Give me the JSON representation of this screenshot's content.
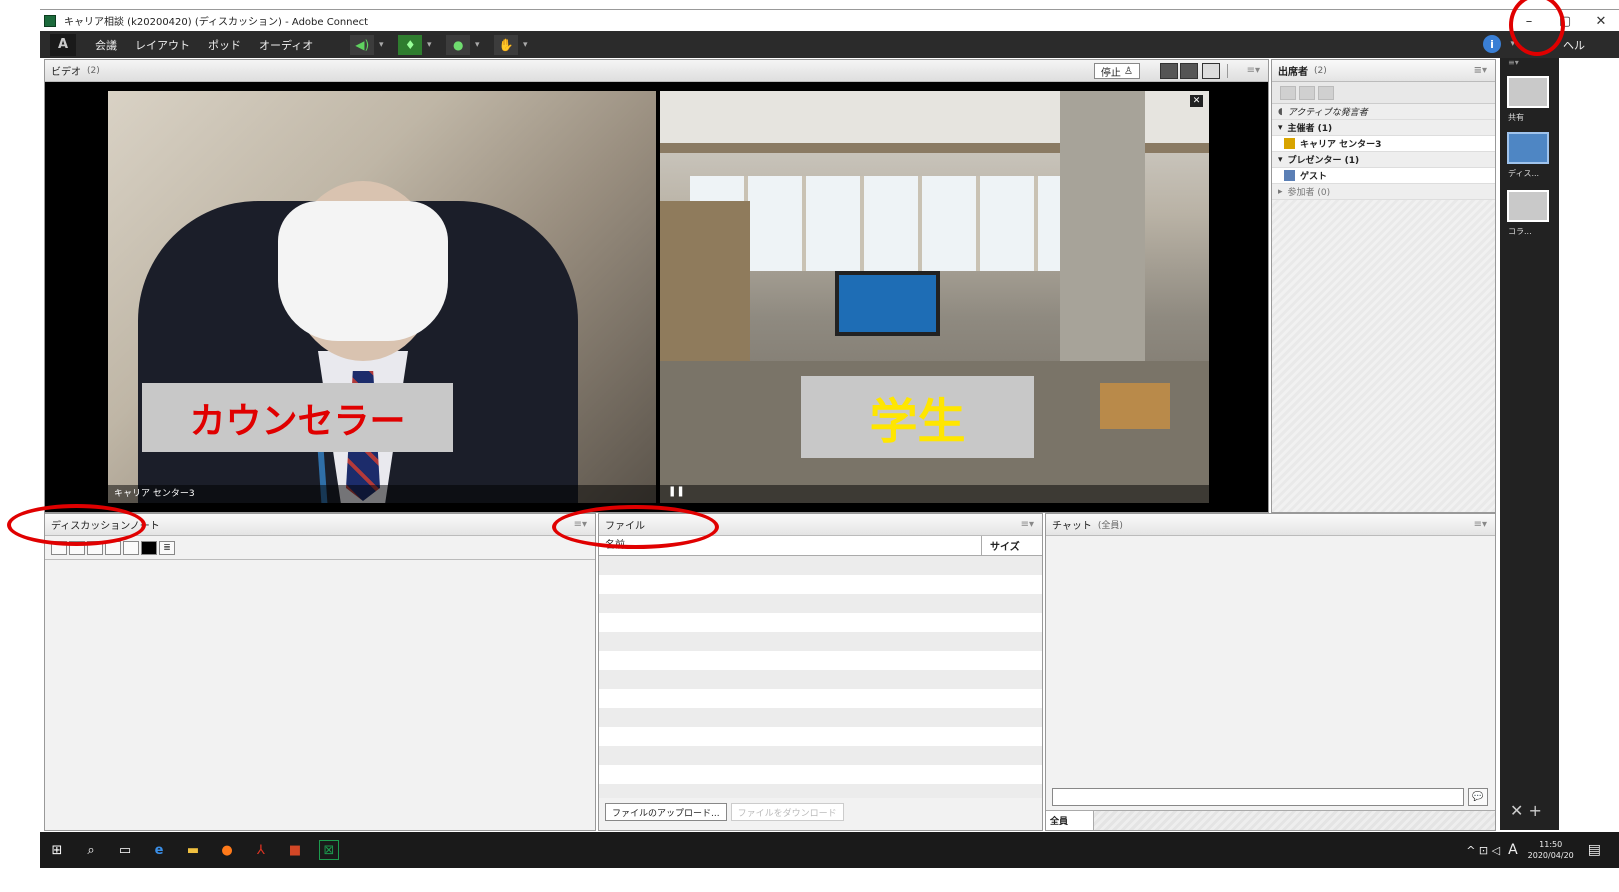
{
  "window": {
    "title": "キャリア相談 (k20200420) (ディスカッション) - Adobe Connect",
    "minimize_icon": "–",
    "restore_icon": "▢",
    "close_icon": "✕"
  },
  "menubar": {
    "logo": "A",
    "items": [
      "会議",
      "レイアウト",
      "ポッド",
      "オーディオ"
    ],
    "help_label": "ヘル"
  },
  "video_pod": {
    "title": "ビデオ",
    "count": "(2)",
    "stop_label": "停止",
    "counselor_name": "キャリア センター3",
    "counselor_overlay": "カウンセラー",
    "student_overlay": "学生",
    "close_glyph": "✕",
    "pause_glyph": "❚❚"
  },
  "attendees_pod": {
    "title": "出席者",
    "count": "(2)",
    "active_speakers": "アクティブな発言者",
    "hosts_group": "主催者 (1)",
    "host_name": "キャリア センター3",
    "presenters_group": "プレゼンター (1)",
    "presenter_name": "ゲスト",
    "participants_group": "参加者 (0)"
  },
  "sidebar": {
    "layouts": [
      "共有",
      "ディス...",
      "コラ..."
    ],
    "tools": "✕ +"
  },
  "notes_pod": {
    "title": "ディスカッションノート"
  },
  "files_pod": {
    "title": "ファイル",
    "col_name": "名前",
    "col_size": "サイズ",
    "upload_btn": "ファイルのアップロード...",
    "download_btn": "ファイルをダウンロード"
  },
  "chat_pod": {
    "title": "チャット",
    "scope": "(全員)",
    "tab_all": "全員",
    "send_glyph": "💬"
  },
  "taskbar": {
    "clock_time": "11:50",
    "clock_date": "2020/04/20",
    "ime": "A",
    "tray_icons": "^ ⊡ ◁"
  },
  "colors": {
    "annotation_red": "#e00000",
    "counselor_label": "#e00000",
    "student_label": "#ffe600"
  }
}
